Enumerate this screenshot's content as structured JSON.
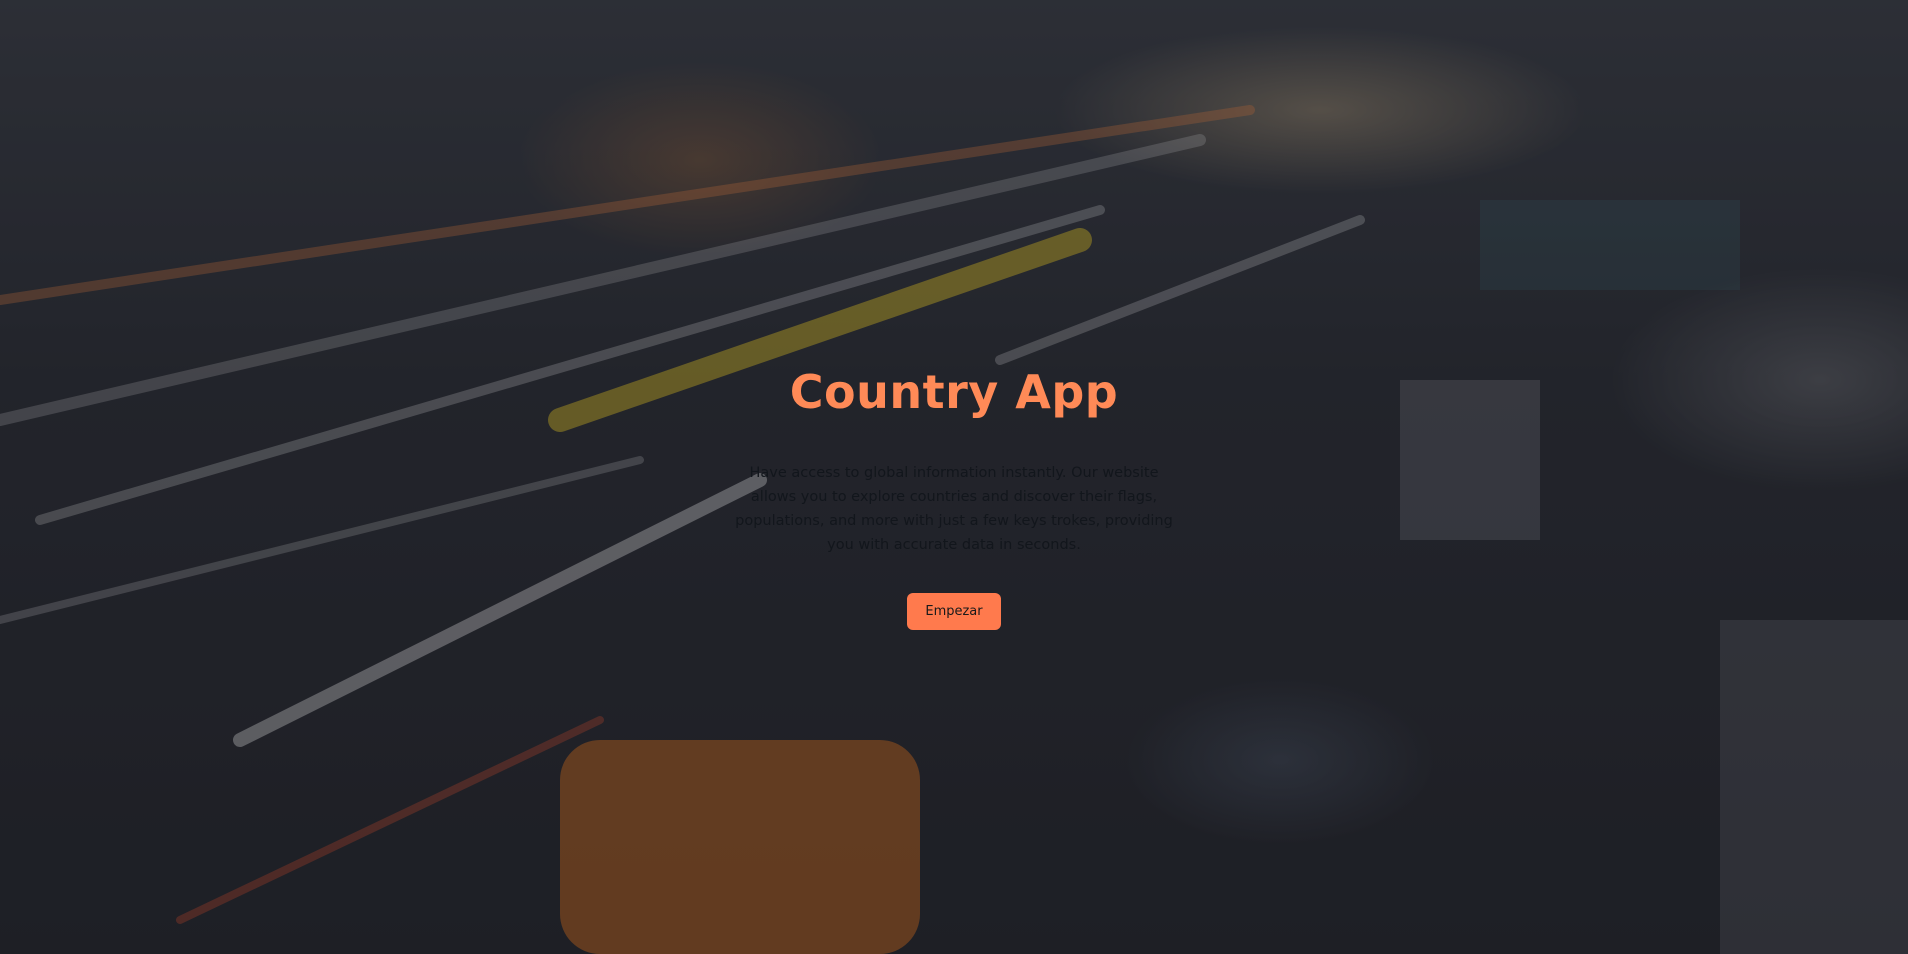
{
  "hero": {
    "title": "Country App",
    "description": "Have access to global information instantly. Our website allows you to explore countries and discover their flags, populations, and more with just a few keys trokes, providing you with accurate data in seconds.",
    "cta_label": "Empezar"
  },
  "colors": {
    "accent": "#ff8a57",
    "button": "#ff7a4d",
    "overlay": "#14161c"
  }
}
